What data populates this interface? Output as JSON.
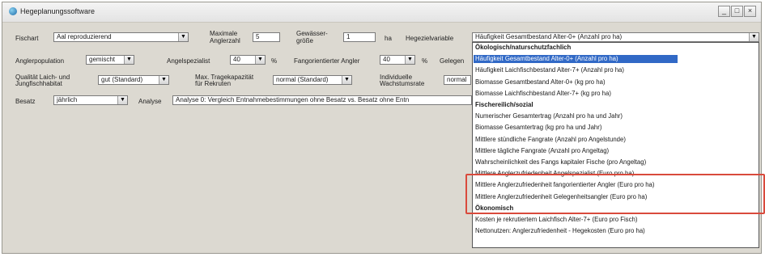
{
  "window": {
    "title": "Hegeplanungssoftware",
    "buttons": [
      "_",
      "□",
      "×"
    ]
  },
  "form": {
    "fischart_label": "Fischart",
    "fischart_value": "Aal reproduzierend",
    "max_angler_label_1": "Maximale",
    "max_angler_label_2": "Anglerzahl",
    "max_angler_value": "5",
    "gewaesser_label_1": "Gewässer-",
    "gewaesser_label_2": "größe",
    "gewaesser_value": "1",
    "gewaesser_unit": "ha",
    "zielvariable_label": "Hegezielvariable",
    "zielvariable_value": "Häufigkeit Gesamtbestand Alter-0+ (Anzahl pro ha)",
    "anglerpopulation_label": "Anglerpopulation",
    "anglerpopulation_value": "gemischt",
    "angelspezialist_label": "Angelspezialist",
    "angelspezialist_value": "40",
    "angelspezialist_unit": "%",
    "fangorientiert_label": "Fangorientierter Angler",
    "fangorientiert_value": "40",
    "fangorientiert_unit": "%",
    "gelegenheit_label": "Gelegen",
    "qualitaet_label_1": "Qualität Laich- und",
    "qualitaet_label_2": "Jungfischhabitat",
    "qualitaet_value": "gut (Standard)",
    "tragekapazitaet_label_1": "Max. Tragekapazität",
    "tragekapazitaet_label_2": "für Rekruten",
    "tragekapazitaet_value": "normal (Standard)",
    "wachstum_label_1": "Individuelle",
    "wachstum_label_2": "Wachstumsrate",
    "wachstum_value": "normal",
    "besatz_label": "Besatz",
    "besatz_value": "jährlich",
    "analyse_label": "Analyse",
    "analyse_value": "Analyse 0: Vergleich Entnahmebestimmungen ohne Besatz vs. Besatz ohne Entn"
  },
  "dropdown": {
    "items": [
      {
        "text": "Ökologisch/naturschutzfachlich",
        "group": true
      },
      {
        "text": "Häufigkeit Gesamtbestand Alter-0+ (Anzahl pro ha)",
        "selected": true
      },
      {
        "text": "Häufigkeit Laichfischbestand Alter-7+ (Anzahl pro ha)"
      },
      {
        "text": "Biomasse Gesamtbestand Alter-0+ (kg pro ha)"
      },
      {
        "text": "Biomasse Laichfischbestand Alter-7+ (kg pro ha)"
      },
      {
        "text": "Fischereilich/sozial",
        "group": true
      },
      {
        "text": "Numerischer Gesamtertrag (Anzahl pro ha und Jahr)"
      },
      {
        "text": "Biomasse Gesamtertrag (kg pro ha und Jahr)"
      },
      {
        "text": "Mittlere stündliche Fangrate (Anzahl pro Angelstunde)"
      },
      {
        "text": "Mittlere tägliche Fangrate (Anzahl pro Angeltag)"
      },
      {
        "text": "Wahrscheinlichkeit des Fangs kapitaler Fische (pro Angeltag)"
      },
      {
        "text": "Mittlere Anglerzufriedenheit Angelspezialist (Euro pro ha)"
      },
      {
        "text": "Mittlere Anglerzufriedenheit fangorientierter Angler (Euro pro ha)"
      },
      {
        "text": "Mittlere Anglerzufriedenheit Gelegenheitsangler (Euro pro ha)"
      },
      {
        "text": "Ökonomisch",
        "group": true
      },
      {
        "text": "Kosten je rekrutiertem Laichfisch Alter-7+ (Euro pro Fisch)"
      },
      {
        "text": "Nettonutzen: Anglerzufriedenheit - Hegekosten (Euro pro ha)"
      }
    ]
  }
}
